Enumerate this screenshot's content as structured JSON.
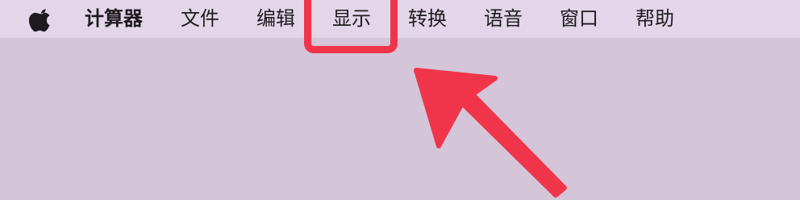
{
  "menubar": {
    "apple_icon": "apple-logo-icon",
    "app_name": "计算器",
    "items": [
      "文件",
      "编辑",
      "显示",
      "转换",
      "语音",
      "窗口",
      "帮助"
    ]
  },
  "annotation": {
    "highlighted_item": "显示",
    "color": "#f0354a",
    "shape": "rounded-rectangle",
    "pointer": "arrow-icon"
  },
  "colors": {
    "menubar_bg": "#e2d6e8",
    "desktop_bg": "#d4c5d9",
    "text": "#1e1a1f"
  }
}
